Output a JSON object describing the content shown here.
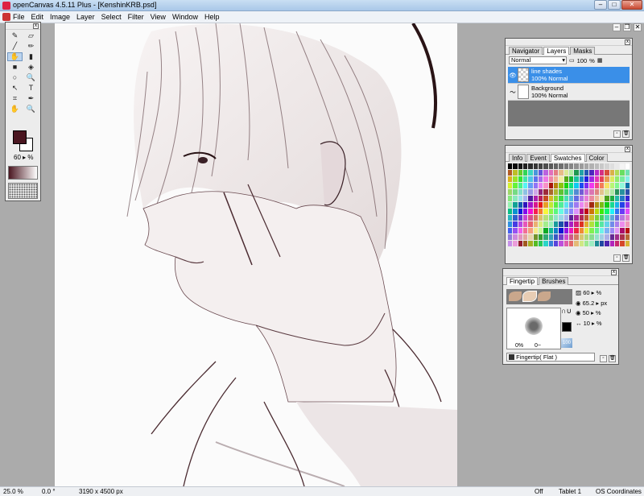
{
  "window": {
    "title": "openCanvas 4.5.11 Plus - [KenshinKRB.psd]",
    "btn_min": "–",
    "btn_max": "□",
    "btn_close": "✕"
  },
  "menu": [
    "File",
    "Edit",
    "Image",
    "Layer",
    "Select",
    "Filter",
    "View",
    "Window",
    "Help"
  ],
  "mdi": {
    "min": "–",
    "restore": "❐",
    "close": "✕"
  },
  "toolbox": {
    "tools": [
      "✎",
      "▱",
      "╱",
      "✏",
      "✋",
      "▮",
      "■",
      "◈",
      "○",
      "🔍",
      "↖",
      "T",
      "⌗",
      "✒",
      "✋",
      "🔍"
    ],
    "size_value": "60",
    "size_unit": "%",
    "close": "x"
  },
  "layers_panel": {
    "tabs": [
      "Navigator",
      "Layers",
      "Masks"
    ],
    "blend_mode": "Normal",
    "opacity": "100",
    "opacity_unit": "%",
    "layers": [
      {
        "name": "line shades",
        "info": "100% Normal",
        "selected": true
      },
      {
        "name": "Background",
        "info": "100% Normal",
        "selected": false
      }
    ]
  },
  "swatches_panel": {
    "tabs": [
      "Info",
      "Event",
      "Swatches",
      "Color"
    ]
  },
  "brush_panel": {
    "tabs": [
      "Fingertip",
      "Brushes"
    ],
    "params": [
      {
        "value": "60",
        "unit": "%"
      },
      {
        "value": "65.2",
        "unit": "px"
      },
      {
        "value": "50",
        "unit": "%"
      },
      {
        "value": "10",
        "unit": "%"
      }
    ],
    "preview_labels": [
      "0%",
      "0~"
    ],
    "scale_value": "100",
    "preset_name": "Fingertip( Flat )"
  },
  "status": {
    "zoom": "25.0 %",
    "angle": "0.0 °",
    "size": "3190 x 4500 px",
    "mode": "Off",
    "tablet": "Tablet 1",
    "coords": "OS Coordinates"
  }
}
